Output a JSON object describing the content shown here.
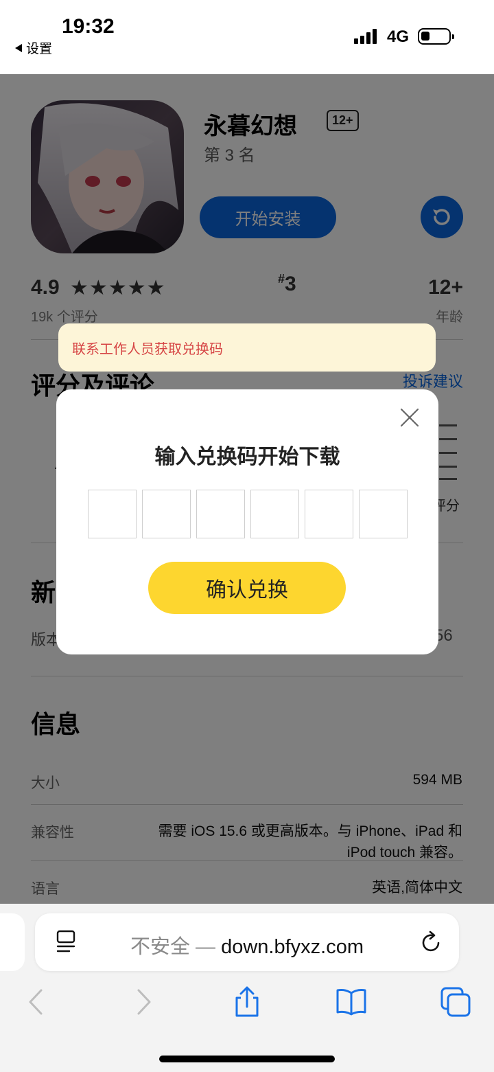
{
  "status_bar": {
    "time": "19:32",
    "back_app": "设置",
    "network": "4G"
  },
  "app": {
    "name": "永暮幻想",
    "age_badge": "12+",
    "rank_subtitle": "第 3 名",
    "install_label": "开始安装",
    "rating": "4.9",
    "stars": "★★★★★",
    "rating_count": "19k 个评分",
    "rank_prefix": "#",
    "rank": "3",
    "age": "12+",
    "age_label": "年龄"
  },
  "sections": {
    "ratings_title": "评分及评论",
    "complaint_link": "投诉建议",
    "new_title_partial": "新",
    "version_partial": "版本",
    "version_tail": "56",
    "rating_partial": "评分",
    "info_title": "信息"
  },
  "info_rows": [
    {
      "label": "大小",
      "value": "594 MB"
    },
    {
      "label": "兼容性",
      "value_line1": "需要 iOS 15.6 或更高版本。与 iPhone、iPad 和",
      "value_line2": "iPod touch 兼容。"
    },
    {
      "label": "语言",
      "value": "英语,简体中文"
    }
  ],
  "toast": {
    "text": "联系工作人员获取兑换码"
  },
  "modal": {
    "title": "输入兑换码开始下载",
    "code_length": 6,
    "confirm_label": "确认兑换"
  },
  "safari": {
    "insecure_label": "不安全 —",
    "domain": "down.bfyxz.com"
  },
  "colors": {
    "accent_blue": "#0a66df",
    "confirm_yellow": "#fdd62f",
    "toast_bg": "#fdf5d8",
    "toast_text": "#d64545"
  }
}
